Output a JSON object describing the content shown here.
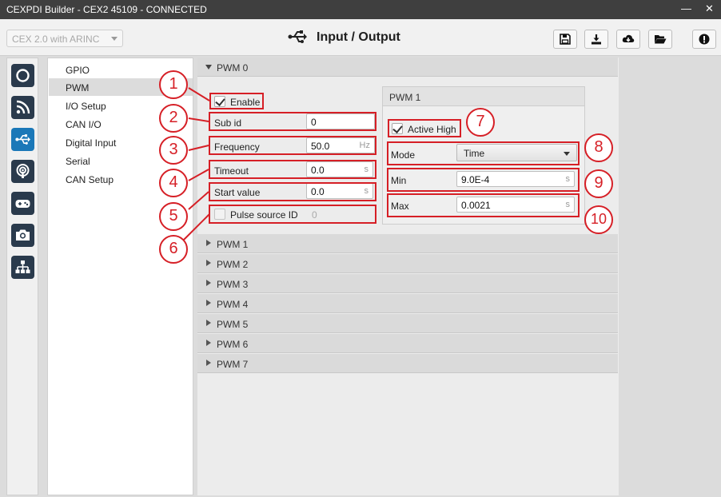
{
  "window": {
    "title": "CEXPDI Builder - CEX2 45109 - CONNECTED",
    "minimize_glyph": "—",
    "close_glyph": "✕"
  },
  "toolbar": {
    "device_select": "CEX 2.0 with ARINC",
    "page_title": "Input / Output",
    "page_icon": "usb-icon",
    "buttons": [
      "save-icon",
      "download-icon",
      "cloud-download-icon",
      "folder-open-icon",
      "info-icon"
    ]
  },
  "iconbar": [
    "power-icon",
    "rss-icon",
    "usb-icon",
    "broadcast-icon",
    "gamepad-icon",
    "camera-icon",
    "network-icon"
  ],
  "nav": {
    "items": [
      "GPIO",
      "PWM",
      "I/O Setup",
      "CAN I/O",
      "Digital Input",
      "Serial",
      "CAN Setup"
    ],
    "selected": "PWM"
  },
  "pwm0": {
    "header": "PWM 0",
    "enable": {
      "label": "Enable",
      "checked": true
    },
    "sub_id": {
      "label": "Sub id",
      "value": "0"
    },
    "frequency": {
      "label": "Frequency",
      "value": "50.0",
      "unit": "Hz"
    },
    "timeout": {
      "label": "Timeout",
      "value": "0.0",
      "unit": "s"
    },
    "start_value": {
      "label": "Start value",
      "value": "0.0",
      "unit": "s"
    },
    "pulse_source": {
      "label": "Pulse source ID",
      "value": "0",
      "checked": false
    }
  },
  "pwm1_panel": {
    "header": "PWM 1",
    "active_high": {
      "label": "Active High",
      "checked": true
    },
    "mode": {
      "label": "Mode",
      "value": "Time"
    },
    "min": {
      "label": "Min",
      "value": "9.0E-4",
      "unit": "s"
    },
    "max": {
      "label": "Max",
      "value": "0.0021",
      "unit": "s"
    }
  },
  "collapsed_sections": [
    "PWM 1",
    "PWM 2",
    "PWM 3",
    "PWM 4",
    "PWM 5",
    "PWM 6",
    "PWM 7"
  ],
  "callouts": [
    "1",
    "2",
    "3",
    "4",
    "5",
    "6",
    "7",
    "8",
    "9",
    "10"
  ],
  "colors": {
    "accent": "#1b78b8",
    "annotation": "#d61f26",
    "titlebar": "#3f3f3f",
    "icon_button": "#2a3a4c"
  }
}
